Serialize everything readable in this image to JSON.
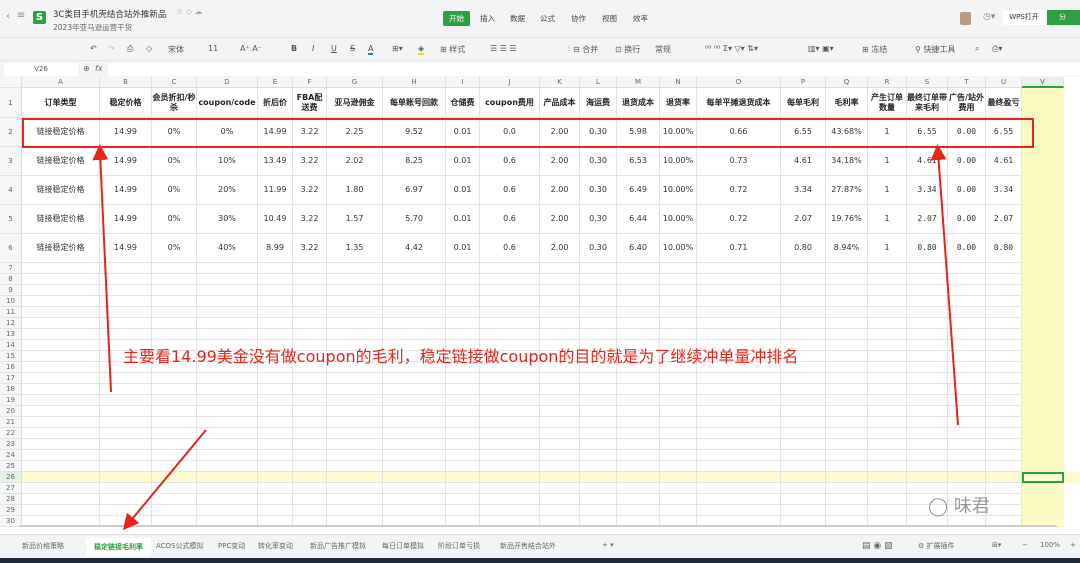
{
  "window": {
    "doc_title": "3C类目手机壳结合站外推新品",
    "folder": "2023年亚马逊运营干货",
    "open_with": "WPS打开",
    "share": "分"
  },
  "menu": [
    "开始",
    "插入",
    "数据",
    "公式",
    "协作",
    "视图",
    "效率"
  ],
  "toolbar": {
    "font": "宋体",
    "size": "11",
    "style": "样式",
    "merge": "合并",
    "wrap": "换行",
    "format": "常规",
    "freeze": "冻结",
    "quick_tools": "快捷工具"
  },
  "formula_bar": {
    "cell_ref": "V26",
    "fx": "fx"
  },
  "columns": [
    "A",
    "B",
    "C",
    "D",
    "E",
    "F",
    "G",
    "H",
    "I",
    "J",
    "K",
    "L",
    "M",
    "N",
    "O",
    "P",
    "Q",
    "R",
    "S",
    "T",
    "U",
    "V"
  ],
  "headers": [
    "订单类型",
    "稳定价格",
    "会员折扣/秒杀",
    "coupon/code",
    "折后价",
    "FBA配送费",
    "亚马逊佣金",
    "每单账号回款",
    "仓储费",
    "coupon费用",
    "产品成本",
    "海运费",
    "退货成本",
    "退货率",
    "每单平摊退货成本",
    "每单毛利",
    "毛利率",
    "产生订单数量",
    "最终订单带来毛利",
    "广告/站外费用",
    "最终盈亏"
  ],
  "rows": [
    [
      "链接稳定价格",
      "14.99",
      "0%",
      "0%",
      "14.99",
      "3.22",
      "2.25",
      "9.52",
      "0.01",
      "0.0",
      "2.00",
      "0.30",
      "5.98",
      "10.00%",
      "0.66",
      "6.55",
      "43.68%",
      "1",
      "6.55",
      "0.00",
      "6.55"
    ],
    [
      "链接稳定价格",
      "14.99",
      "0%",
      "10%",
      "13.49",
      "3.22",
      "2.02",
      "8.25",
      "0.01",
      "0.6",
      "2.00",
      "0.30",
      "6.53",
      "10.00%",
      "0.73",
      "4.61",
      "34.18%",
      "1",
      "4.61",
      "0.00",
      "4.61"
    ],
    [
      "链接稳定价格",
      "14.99",
      "0%",
      "20%",
      "11.99",
      "3.22",
      "1.80",
      "6.97",
      "0.01",
      "0.6",
      "2.00",
      "0.30",
      "6.49",
      "10.00%",
      "0.72",
      "3.34",
      "27.87%",
      "1",
      "3.34",
      "0.00",
      "3.34"
    ],
    [
      "链接稳定价格",
      "14.99",
      "0%",
      "30%",
      "10.49",
      "3.22",
      "1.57",
      "5.70",
      "0.01",
      "0.6",
      "2.00",
      "0.30",
      "6.44",
      "10.00%",
      "0.72",
      "2.07",
      "19.76%",
      "1",
      "2.07",
      "0.00",
      "2.07"
    ],
    [
      "链接稳定价格",
      "14.99",
      "0%",
      "40%",
      "8.99",
      "3.22",
      "1.35",
      "4.42",
      "0.01",
      "0.6",
      "2.00",
      "0.30",
      "6.40",
      "10.00%",
      "0.71",
      "0.80",
      "8.94%",
      "1",
      "0.80",
      "0.00",
      "0.80"
    ]
  ],
  "annotation": "主要看14.99美金没有做coupon的毛利，稳定链接做coupon的目的就是为了继续冲单量冲排名",
  "sheet_tabs": [
    "新品价格策略",
    "稳定链接毛利率",
    "ACOS公式模拟",
    "PPC变动",
    "转化率变动",
    "新品广告推广模拟",
    "每日订单模拟",
    "阶段订单亏损",
    "新品开售结合站外"
  ],
  "active_tab": 1,
  "status": {
    "extensions": "扩展插件",
    "zoom": "100%"
  },
  "colors": {
    "accent": "#2ea043",
    "annotation": "#e8231b",
    "selected_col": "#fdfbc4"
  }
}
